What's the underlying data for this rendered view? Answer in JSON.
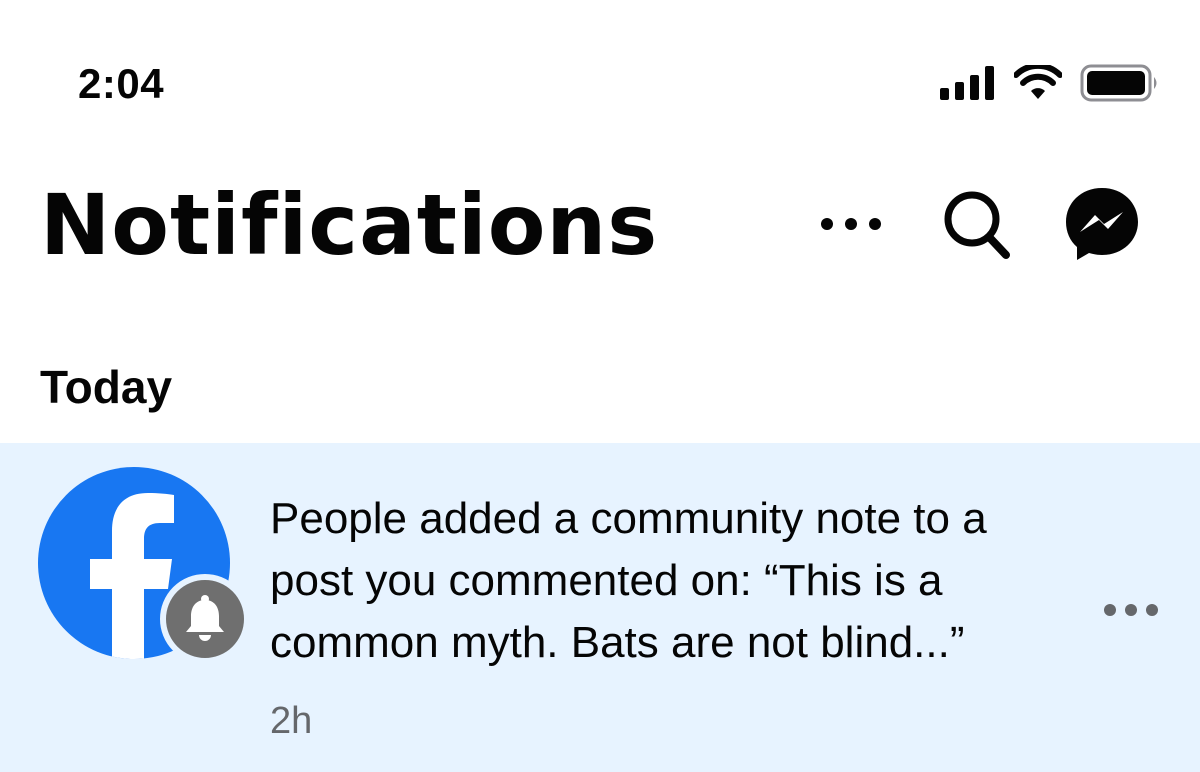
{
  "status_bar": {
    "time": "2:04",
    "icons": [
      "cellular-signal-icon",
      "wifi-icon",
      "battery-icon"
    ]
  },
  "header": {
    "title": "Notifications",
    "actions": [
      "more-options-icon",
      "search-icon",
      "messenger-icon"
    ]
  },
  "sections": [
    {
      "heading": "Today",
      "notifications": [
        {
          "avatar": "facebook-logo-icon",
          "badge": "bell-icon",
          "text": "People added a community note to a post you commented on: “This is a common myth. Bats are not blind...”",
          "time": "2h",
          "unread": true
        }
      ]
    }
  ],
  "colors": {
    "background": "#ffffff",
    "unread_row_background": "#e7f3ff",
    "facebook_blue": "#1877f2",
    "badge_gray": "#6f6f6f",
    "text_primary": "#050505",
    "text_secondary": "#65676b"
  }
}
